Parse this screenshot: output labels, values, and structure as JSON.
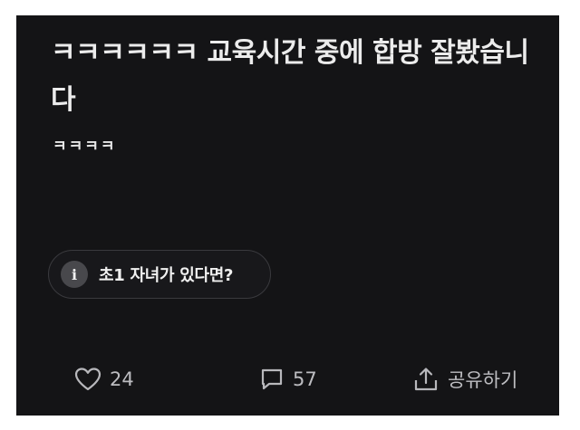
{
  "post": {
    "title": "ㅋㅋㅋㅋㅋㅋ 교육시간 중에 합방 잘봤습니다",
    "body": "ㅋㅋㅋㅋ",
    "info_chip": {
      "icon": "info-icon",
      "icon_glyph": "i",
      "label": "초1 자녀가 있다면?"
    }
  },
  "actions": {
    "like": {
      "icon": "heart-icon",
      "count": "24"
    },
    "comment": {
      "icon": "comment-icon",
      "count": "57"
    },
    "share": {
      "icon": "share-icon",
      "label": "공유하기"
    }
  },
  "colors": {
    "background": "#141416",
    "text": "#ececec",
    "muted": "#b8b8bc"
  }
}
